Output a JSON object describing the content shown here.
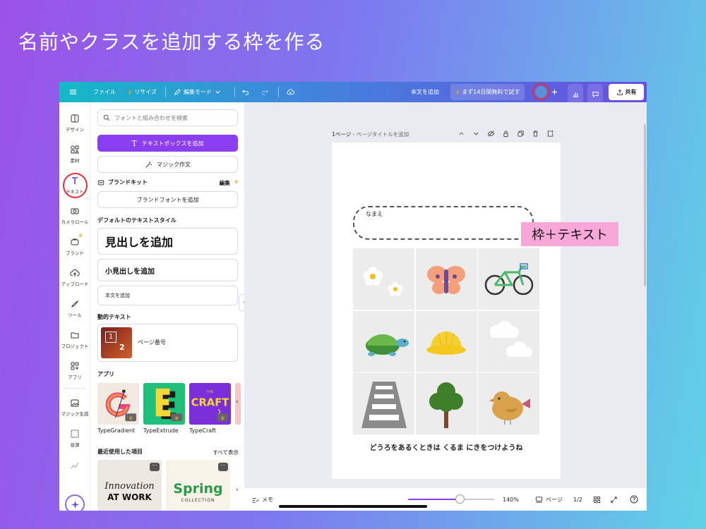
{
  "slide": {
    "title": "名前やクラスを追加する枠を作る"
  },
  "topbar": {
    "file": "ファイル",
    "resize": "リサイズ",
    "edit_mode": "編集モード",
    "add_body": "本文を追加",
    "trial": "まず14日間無料で試す",
    "share": "共有"
  },
  "rail": {
    "design": "デザイン",
    "elements": "素材",
    "text": "テキスト",
    "camera_roll": "カメラロール",
    "brand": "ブランド",
    "upload": "アップロード",
    "tools": "ツール",
    "projects": "プロジェクト",
    "apps": "アプリ",
    "magic_gen": "マジック生成",
    "audio": "音源"
  },
  "panel": {
    "search_placeholder": "フォントと組み合わせを検索",
    "add_textbox": "テキストボックスを追加",
    "magic_write": "マジック作文",
    "brand_kit": "ブランドキット",
    "edit": "編集",
    "brand_fonts": "ブランドフォントを追加",
    "default_styles": "デフォルトのテキストスタイル",
    "add_heading": "見出しを追加",
    "add_subheading": "小見出しを追加",
    "add_body_text": "本文を追加",
    "dynamic_text": "動的テキスト",
    "page_number": "ページ番号",
    "apps_title": "アプリ",
    "apps": [
      {
        "name": "TypeGradient"
      },
      {
        "name": "TypeExtrude"
      },
      {
        "name": "TypeCraft"
      }
    ],
    "recent_title": "最近使用した項目",
    "see_all": "すべて表示",
    "recent_1_line1": "Innovation",
    "recent_1_line2": "AT WORK",
    "recent_2_line1": "Spring",
    "recent_2_line2": "COLLECTION"
  },
  "canvas": {
    "page_label": "1ページ",
    "page_title_placeholder": "ページタイトルを追加",
    "name_label": "なまえ",
    "caption": "どうろをあるくときは くるま にきをつけようね",
    "annotation": "枠＋テキスト",
    "cells": [
      {
        "icon": "flowers-icon"
      },
      {
        "icon": "butterfly-icon"
      },
      {
        "icon": "bicycle-icon"
      },
      {
        "icon": "turtle-icon"
      },
      {
        "icon": "school-hat-icon"
      },
      {
        "icon": "clouds-icon"
      },
      {
        "icon": "crosswalk-icon"
      },
      {
        "icon": "tree-icon"
      },
      {
        "icon": "bird-icon"
      }
    ]
  },
  "bottombar": {
    "notes": "メモ",
    "zoom_text": "140%",
    "zoom_fraction": 0.6,
    "pages": "ページ",
    "page_count": "1/2"
  },
  "colors": {
    "accent": "#8b3df0",
    "highlight_circle": "#e62e3a",
    "annotation_bg": "#f7a8d8"
  }
}
